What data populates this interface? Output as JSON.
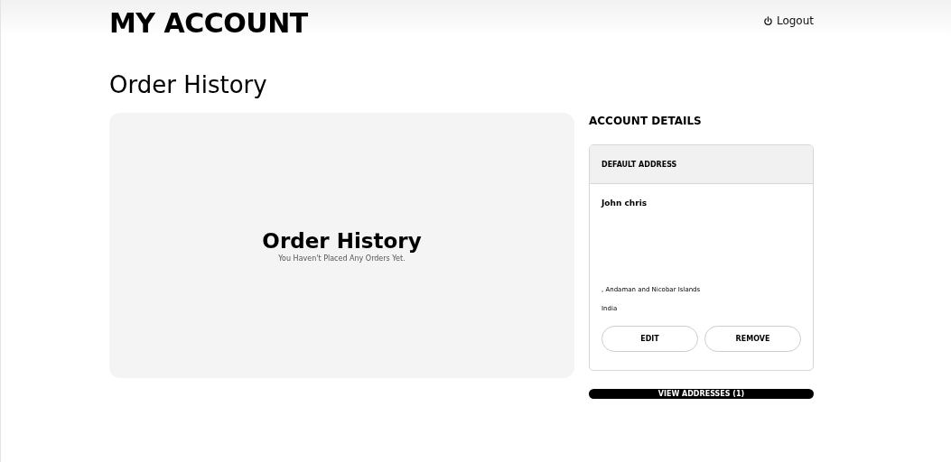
{
  "header": {
    "title": "MY ACCOUNT",
    "logout": "Logout"
  },
  "section_title": "Order History",
  "order_history": {
    "title": "Order History",
    "message": "You Haven't Placed Any Orders Yet."
  },
  "account_details": {
    "title": "ACCOUNT DETAILS",
    "card_title": "DEFAULT ADDRESS",
    "name": "John chris",
    "address_lines": [
      ", Andaman and Nicobar Islands",
      "India"
    ],
    "buttons": [
      "EDIT",
      "REMOVE"
    ],
    "view_button": "VIEW ADDRESSES (1)"
  }
}
